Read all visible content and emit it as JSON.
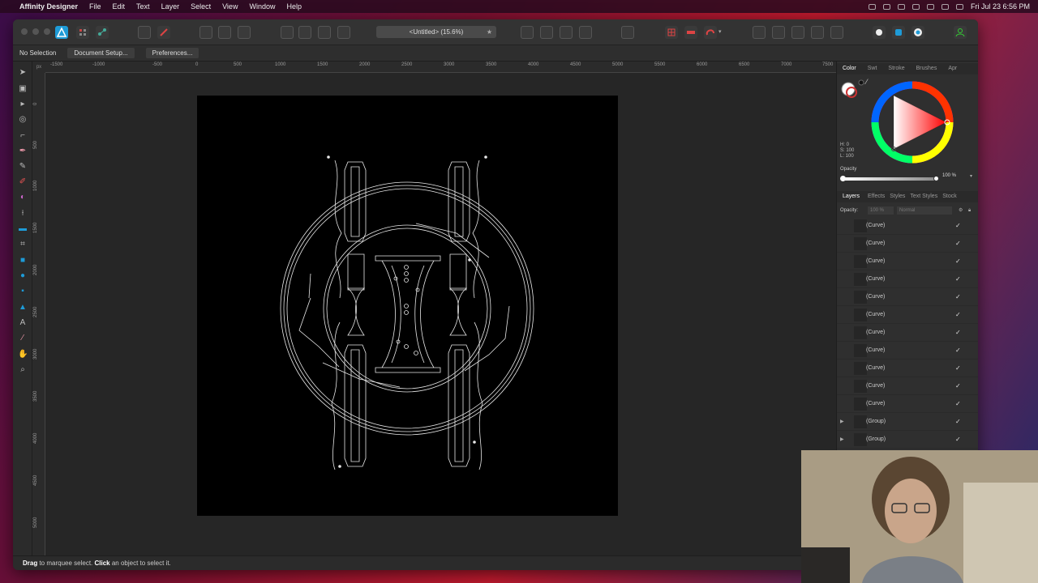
{
  "menubar": {
    "app_name": "Affinity Designer",
    "items": [
      "File",
      "Edit",
      "Text",
      "Layer",
      "Select",
      "View",
      "Window",
      "Help"
    ],
    "clock": "Fri Jul 23  6:56 PM"
  },
  "window": {
    "doc_title": "<Untitled> (15.6%)",
    "star": "★"
  },
  "context_bar": {
    "selection": "No Selection",
    "document_setup": "Document Setup...",
    "preferences": "Preferences..."
  },
  "ruler": {
    "unit": "px",
    "h_ticks": [
      "-1500",
      "-1000",
      "-500",
      "0",
      "500",
      "1000",
      "1500",
      "2000",
      "2500",
      "3000",
      "3500",
      "4000",
      "4500",
      "5000",
      "5500",
      "6000",
      "6500",
      "7000",
      "7500"
    ],
    "v_ticks": [
      "0",
      "500",
      "1000",
      "1500",
      "2000",
      "2500",
      "3000",
      "3500",
      "4000",
      "4500",
      "5000"
    ]
  },
  "color_panel": {
    "tabs": [
      "Color",
      "Swt",
      "Stroke",
      "Brushes",
      "Apr"
    ],
    "h": "H: 0",
    "s": "S: 100",
    "l": "L: 100",
    "opacity_label": "Opacity",
    "opacity_value": "100 %",
    "fill": "#ffffff"
  },
  "layers_panel": {
    "tabs": [
      "Layers",
      "Effects",
      "Styles",
      "Text Styles",
      "Stock"
    ],
    "opacity_label": "Opacity:",
    "opacity_field": "100 %",
    "blend_mode": "Normal",
    "layers": [
      {
        "name": "(Curve)",
        "check": "✓",
        "arrow": ""
      },
      {
        "name": "(Curve)",
        "check": "✓",
        "arrow": ""
      },
      {
        "name": "(Curve)",
        "check": "✓",
        "arrow": ""
      },
      {
        "name": "(Curve)",
        "check": "✓",
        "arrow": ""
      },
      {
        "name": "(Curve)",
        "check": "✓",
        "arrow": ""
      },
      {
        "name": "(Curve)",
        "check": "✓",
        "arrow": ""
      },
      {
        "name": "(Curve)",
        "check": "✓",
        "arrow": ""
      },
      {
        "name": "(Curve)",
        "check": "✓",
        "arrow": ""
      },
      {
        "name": "(Curve)",
        "check": "✓",
        "arrow": ""
      },
      {
        "name": "(Curve)",
        "check": "✓",
        "arrow": ""
      },
      {
        "name": "(Curve)",
        "check": "✓",
        "arrow": ""
      },
      {
        "name": "(Group)",
        "check": "✓",
        "arrow": "▶"
      },
      {
        "name": "(Group)",
        "check": "✓",
        "arrow": "▶"
      }
    ]
  },
  "status": {
    "drag": "Drag",
    "drag_text": " to marquee select. ",
    "click": "Click",
    "click_text": " an object to select it."
  },
  "colors": {
    "accent": "#1e9bd7",
    "canvas": "#262626",
    "artboard": "#000000",
    "artwork_stroke": "#e8e8e8"
  }
}
